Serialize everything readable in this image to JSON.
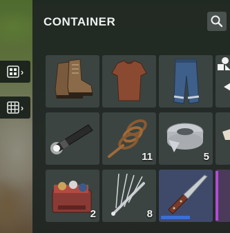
{
  "panel": {
    "title": "CONTAINER",
    "search_icon": "magnifier-icon"
  },
  "side_tabs": [
    {
      "icon": "grid-small-icon",
      "arrow": "›"
    },
    {
      "icon": "grid-large-icon",
      "arrow": "›"
    }
  ],
  "items": [
    {
      "name": "boots",
      "icon": "boots-icon",
      "quantity": ""
    },
    {
      "name": "t-shirt",
      "icon": "tshirt-icon",
      "quantity": ""
    },
    {
      "name": "jeans",
      "icon": "jeans-icon",
      "quantity": ""
    },
    {
      "name": "clothing-category",
      "icon": "clothing-shapes-icon",
      "quantity": ""
    },
    {
      "name": "flashlight",
      "icon": "flashlight-icon",
      "quantity": ""
    },
    {
      "name": "rope",
      "icon": "rope-icon",
      "quantity": "11"
    },
    {
      "name": "duct-tape",
      "icon": "duct-tape-icon",
      "quantity": "5"
    },
    {
      "name": "clipped-item",
      "icon": "clipped-item-icon",
      "quantity": ""
    },
    {
      "name": "sewing-kit",
      "icon": "sewing-kit-icon",
      "quantity": "2"
    },
    {
      "name": "lockpicks",
      "icon": "lockpicks-icon",
      "quantity": "8"
    },
    {
      "name": "knife",
      "icon": "knife-icon",
      "quantity": "",
      "selected": true,
      "durability": 0.55
    },
    {
      "name": "purple-item",
      "icon": "purple-item-icon",
      "quantity": ""
    }
  ],
  "colors": {
    "panel": "#1e2522",
    "cell": "#3b4441",
    "selected_cell": "#3f4a6b",
    "durability_bar": "#3b6fd6",
    "rarity_purple": "#b24ad8"
  }
}
